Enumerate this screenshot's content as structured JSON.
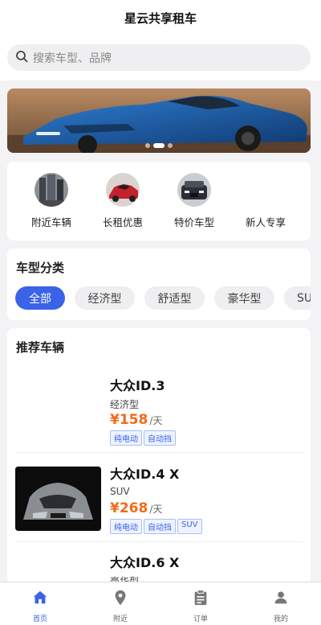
{
  "app": {
    "title": "星云共享租车"
  },
  "search": {
    "placeholder": "搜索车型、品牌"
  },
  "quick_entries": [
    {
      "label": "附近车辆"
    },
    {
      "label": "长租优惠"
    },
    {
      "label": "特价车型"
    },
    {
      "label": "新人专享"
    }
  ],
  "categories": {
    "title": "车型分类",
    "items": [
      "全部",
      "经济型",
      "舒适型",
      "豪华型",
      "SUV"
    ],
    "selected": "全部"
  },
  "recommend": {
    "title": "推荐车辆",
    "cars": [
      {
        "name": "大众ID.3",
        "type": "经济型",
        "price": "¥158",
        "unit": "/天",
        "tags": [
          "纯电动",
          "自动挡"
        ]
      },
      {
        "name": "大众ID.4 X",
        "type": "SUV",
        "price": "¥268",
        "unit": "/天",
        "tags": [
          "纯电动",
          "自动挡",
          "SUV"
        ]
      },
      {
        "name": "大众ID.6 X",
        "type": "豪华型"
      }
    ]
  },
  "tabbar": {
    "items": [
      {
        "label": "首页",
        "icon": "home-icon"
      },
      {
        "label": "附近",
        "icon": "location-icon"
      },
      {
        "label": "订单",
        "icon": "clipboard-icon"
      },
      {
        "label": "我的",
        "icon": "user-icon"
      }
    ],
    "active": "首页"
  },
  "colors": {
    "accent": "#3b63e8",
    "price": "#f26a1b"
  }
}
